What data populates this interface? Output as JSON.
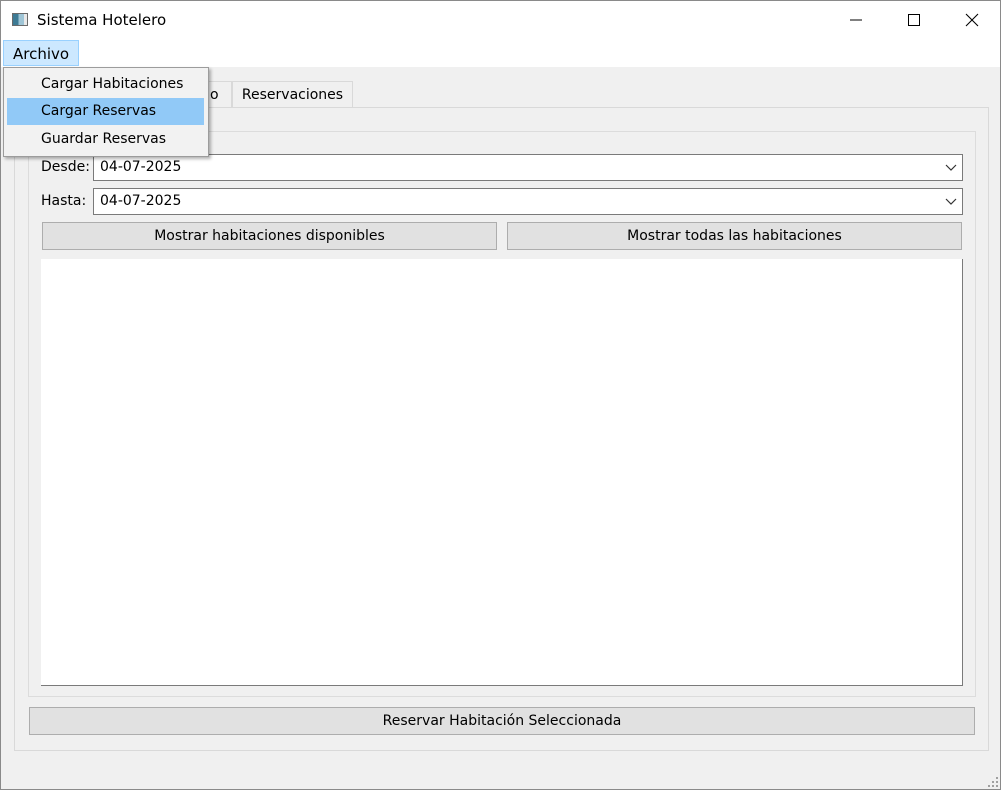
{
  "window": {
    "title": "Sistema Hotelero",
    "icon": "app-window-icon",
    "controls": [
      "minimize-icon",
      "maximize-icon",
      "close-icon"
    ]
  },
  "menubar": {
    "archivo_label": "Archivo",
    "dropdown": {
      "items": [
        "Cargar Habitaciones",
        "Cargar Reservas",
        "Guardar Reservas"
      ],
      "highlighted": "Cargar Reservas"
    }
  },
  "tabs": [
    {
      "label": "o",
      "partially_hidden": true
    },
    {
      "label": "Reservaciones"
    }
  ],
  "form": {
    "desde_label": "Desde:",
    "desde_value": "04-07-2025",
    "hasta_label": "Hasta:",
    "hasta_value": "04-07-2025",
    "show_available_label": "Mostrar habitaciones disponibles",
    "show_all_label": "Mostrar todas las habitaciones",
    "reserve_label": "Reservar Habitación Seleccionada"
  },
  "colors": {
    "menu_highlight": "#91c9f7",
    "menu_active": "#cce8ff",
    "button_face": "#e1e1e1",
    "window_bg": "#f0f0f0"
  }
}
